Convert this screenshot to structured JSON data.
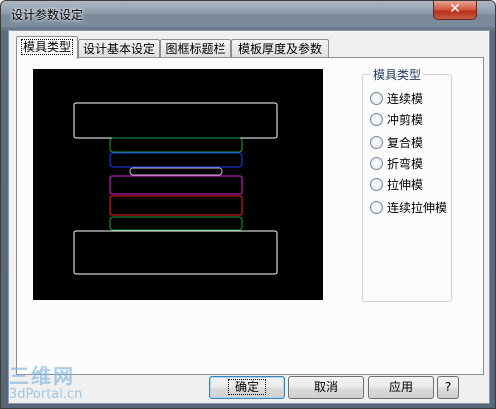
{
  "window": {
    "title": "设计参数设定",
    "close_label": "✕"
  },
  "tabs": [
    {
      "label": "模具类型",
      "active": true
    },
    {
      "label": "设计基本设定"
    },
    {
      "label": "图框标题栏"
    },
    {
      "label": "模板厚度及参数"
    }
  ],
  "mold_type_group": {
    "label": "模具类型",
    "options": [
      "连续模",
      "冲剪模",
      "复合模",
      "折弯模",
      "拉伸模",
      "连续拉伸模"
    ]
  },
  "buttons": {
    "ok": "确定",
    "cancel": "取消",
    "apply": "应用",
    "help": "?"
  },
  "watermark": {
    "line1": "三维网",
    "line2": "3dPortal.cn"
  },
  "colors": {
    "preview_bg": "#000000",
    "white_plate": "#ffffff",
    "green_plate": "#1e9e3a",
    "blue_plate": "#1f3cff",
    "magenta_plate": "#e020e0",
    "red_plate": "#ff1a1a"
  }
}
